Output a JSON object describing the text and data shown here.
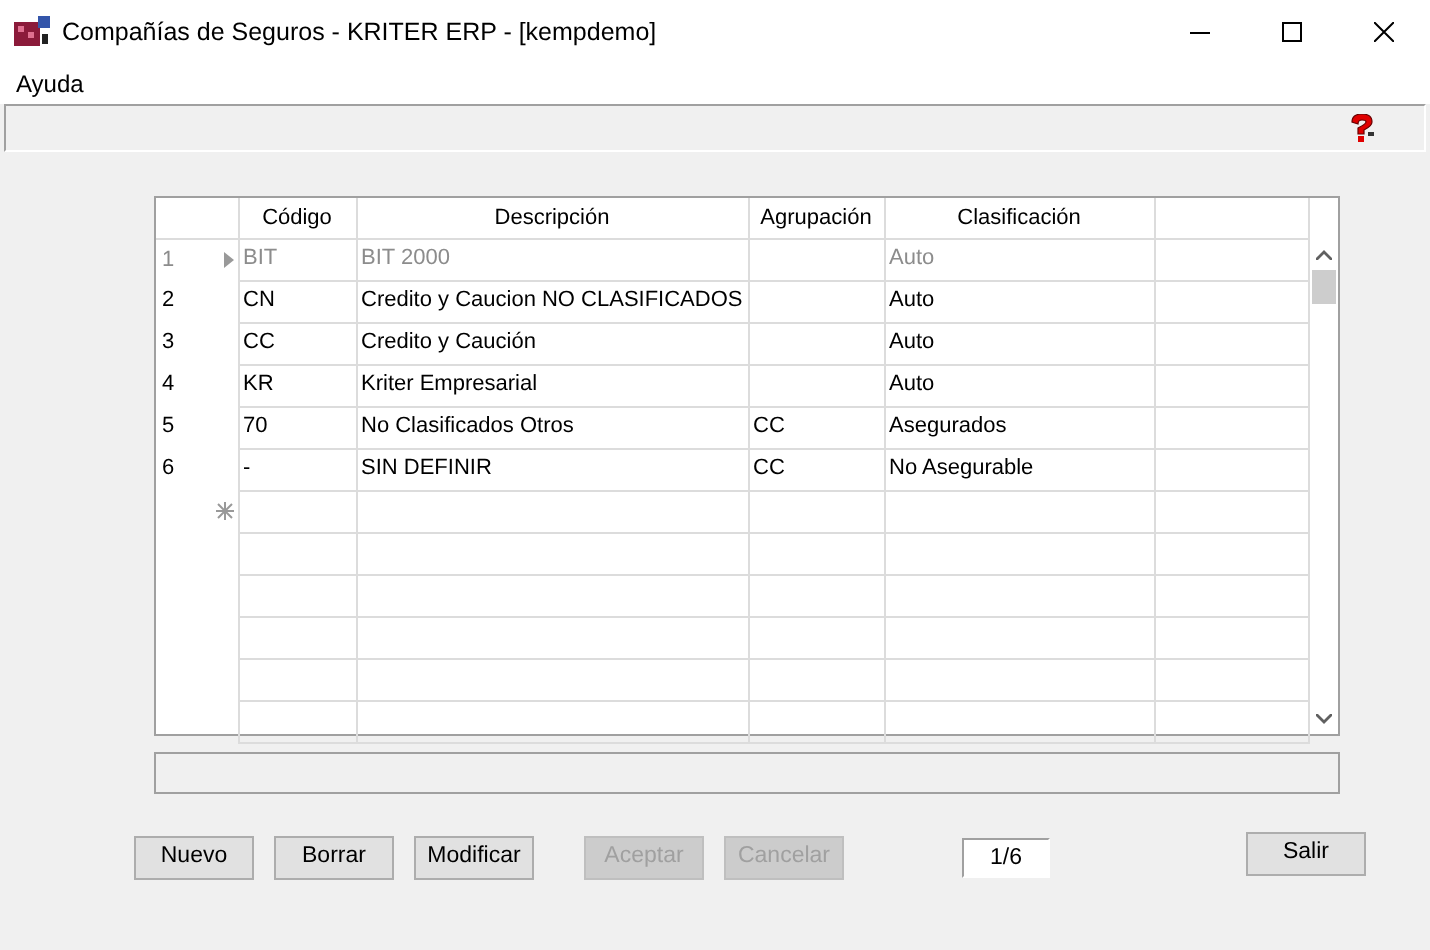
{
  "window": {
    "title": "Compañías de Seguros - KRITER ERP - [kempdemo]"
  },
  "menu": [
    "Ayuda"
  ],
  "table": {
    "columns": [
      "Código",
      "Descripción",
      "Agrupación",
      "Clasificación"
    ],
    "rows": [
      {
        "number": "1",
        "cells": [
          "BIT",
          "BIT 2000",
          "",
          "Auto"
        ],
        "current": true,
        "dimmed": true
      },
      {
        "number": "2",
        "cells": [
          "CN",
          "Credito y Caucion NO CLASIFICADOS",
          "",
          "Auto"
        ],
        "current": false,
        "dimmed": false
      },
      {
        "number": "3",
        "cells": [
          "CC",
          "Credito y Caución",
          "",
          "Auto"
        ],
        "current": false,
        "dimmed": false
      },
      {
        "number": "4",
        "cells": [
          "KR",
          "Kriter Empresarial",
          "",
          "Auto"
        ],
        "current": false,
        "dimmed": false
      },
      {
        "number": "5",
        "cells": [
          "70",
          "No Clasificados Otros",
          "CC",
          "Asegurados"
        ],
        "current": false,
        "dimmed": false
      },
      {
        "number": "6",
        "cells": [
          "-",
          "SIN DEFINIR",
          "CC",
          "No Asegurable"
        ],
        "current": false,
        "dimmed": false
      }
    ]
  },
  "buttons": [
    {
      "label": "Nuevo",
      "disabled": false
    },
    {
      "label": "Borrar",
      "disabled": false
    },
    {
      "label": "Modificar",
      "disabled": false
    },
    {
      "label": "Aceptar",
      "disabled": true
    },
    {
      "label": "Cancelar",
      "disabled": true
    }
  ],
  "record_counter": "1/6",
  "exit_button": {
    "label": "Salir",
    "disabled": false
  }
}
